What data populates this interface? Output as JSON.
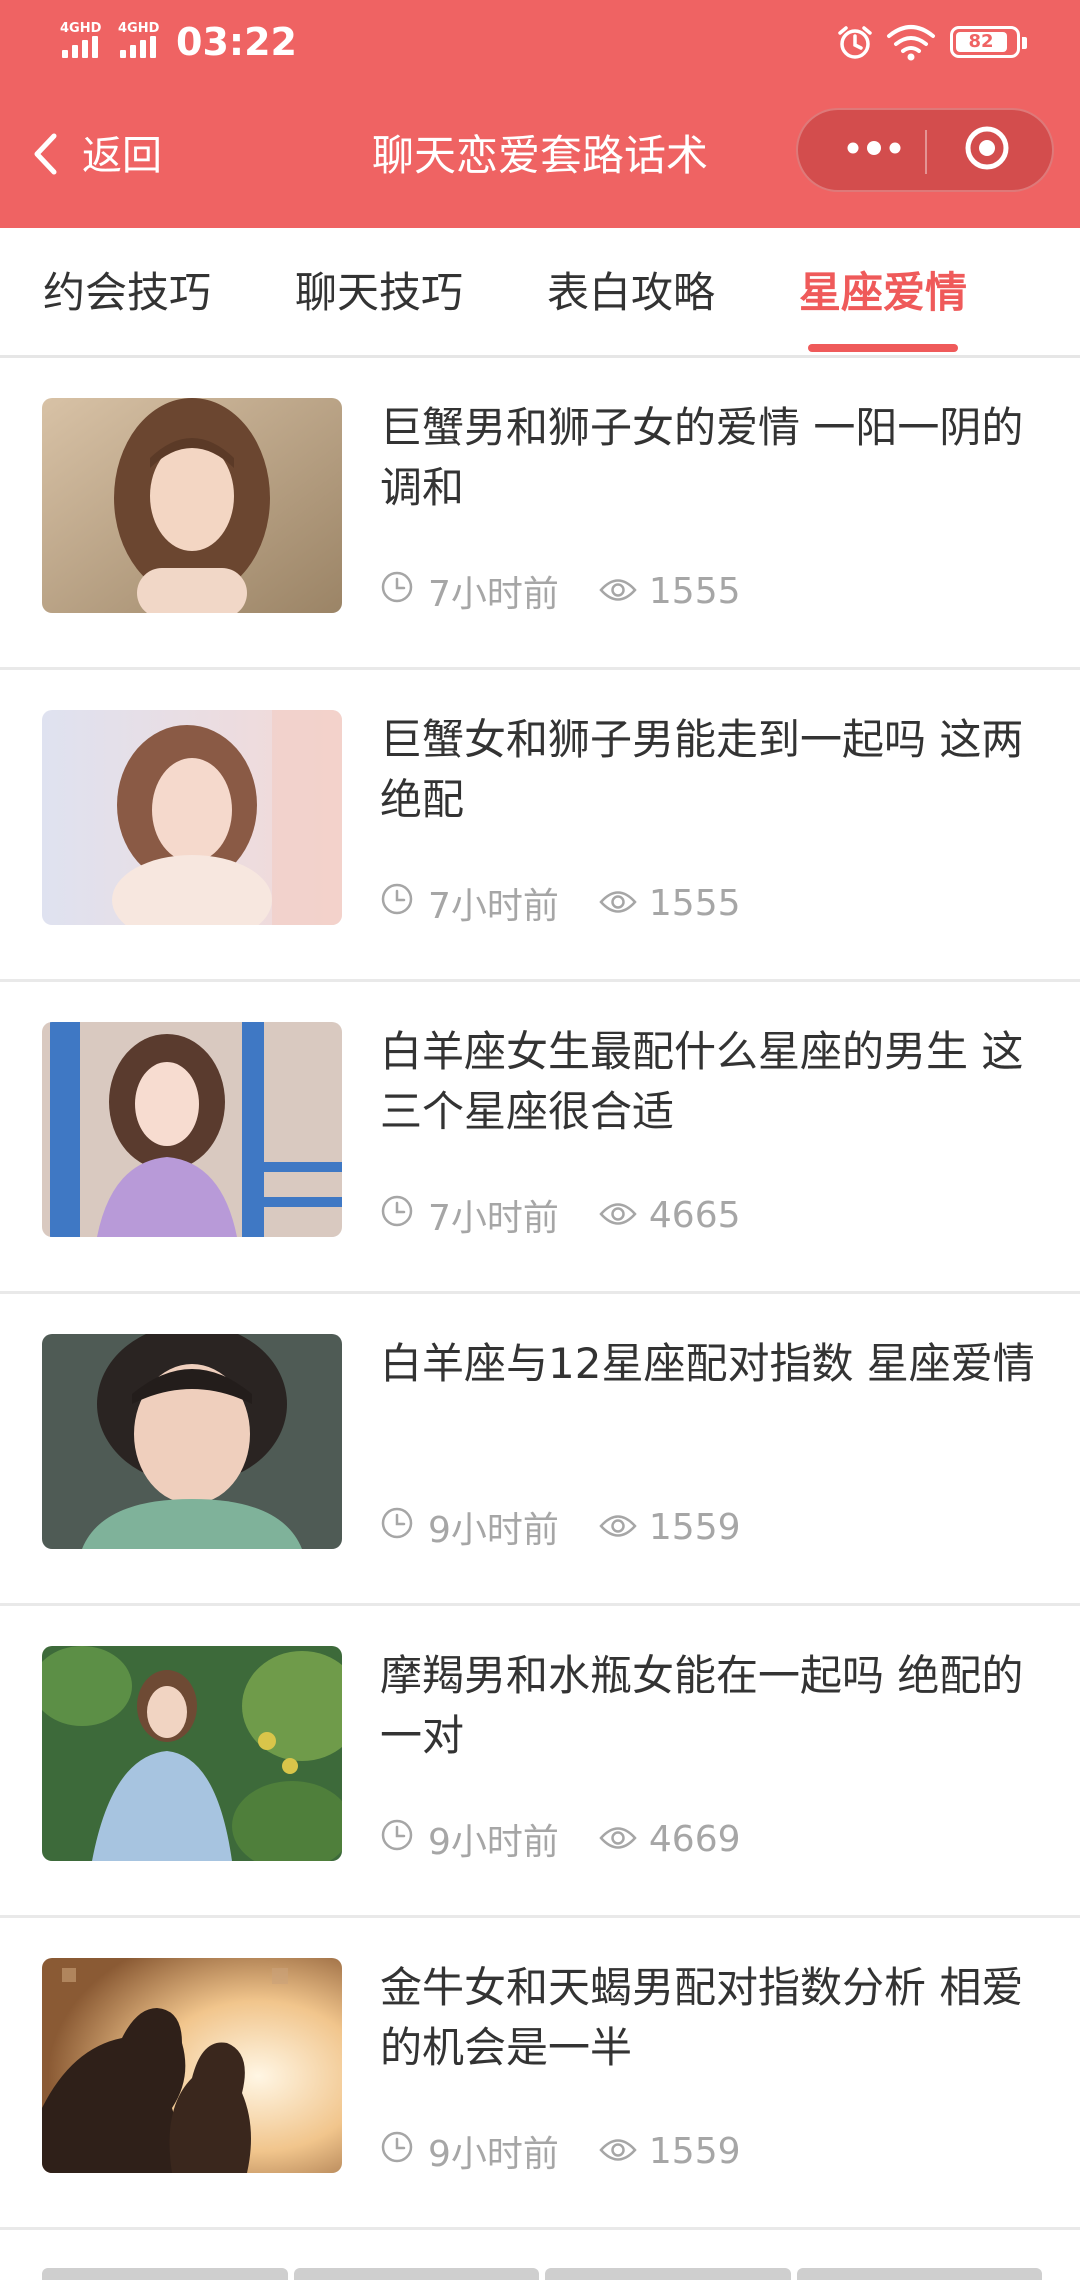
{
  "status_bar": {
    "time": "03:22",
    "signal_1_label": "4GHD",
    "signal_2_label": "4GHD",
    "battery": "82",
    "icons": [
      "signal-icon",
      "signal-icon",
      "alarm-icon",
      "wifi-icon",
      "battery-icon"
    ]
  },
  "nav": {
    "back_label": "返回",
    "title": "聊天恋爱套路话术",
    "icons": [
      "back-arrow-icon",
      "more-dots-icon",
      "close-circle-icon"
    ]
  },
  "tabs": [
    {
      "label": "约会技巧",
      "active": false
    },
    {
      "label": "聊天技巧",
      "active": false
    },
    {
      "label": "表白攻略",
      "active": false
    },
    {
      "label": "星座爱情",
      "active": true
    }
  ],
  "articles": [
    {
      "title": "巨蟹男和狮子女的爱情 一阳一阴的调和",
      "time": "7小时前",
      "views": "1555"
    },
    {
      "title": "巨蟹女和狮子男能走到一起吗 这两绝配",
      "time": "7小时前",
      "views": "1555"
    },
    {
      "title": "白羊座女生最配什么星座的男生 这三个星座很合适",
      "time": "7小时前",
      "views": "4665"
    },
    {
      "title": "白羊座与12星座配对指数 星座爱情",
      "time": "9小时前",
      "views": "1559"
    },
    {
      "title": "摩羯男和水瓶女能在一起吗 绝配的一对",
      "time": "9小时前",
      "views": "4669"
    },
    {
      "title": "金牛女和天蝎男配对指数分析 相爱的机会是一半",
      "time": "9小时前",
      "views": "1559"
    }
  ],
  "colors": {
    "brand": "#ef6363",
    "active_tab": "#ef5a5a",
    "meta_text": "#a6a6a6"
  }
}
